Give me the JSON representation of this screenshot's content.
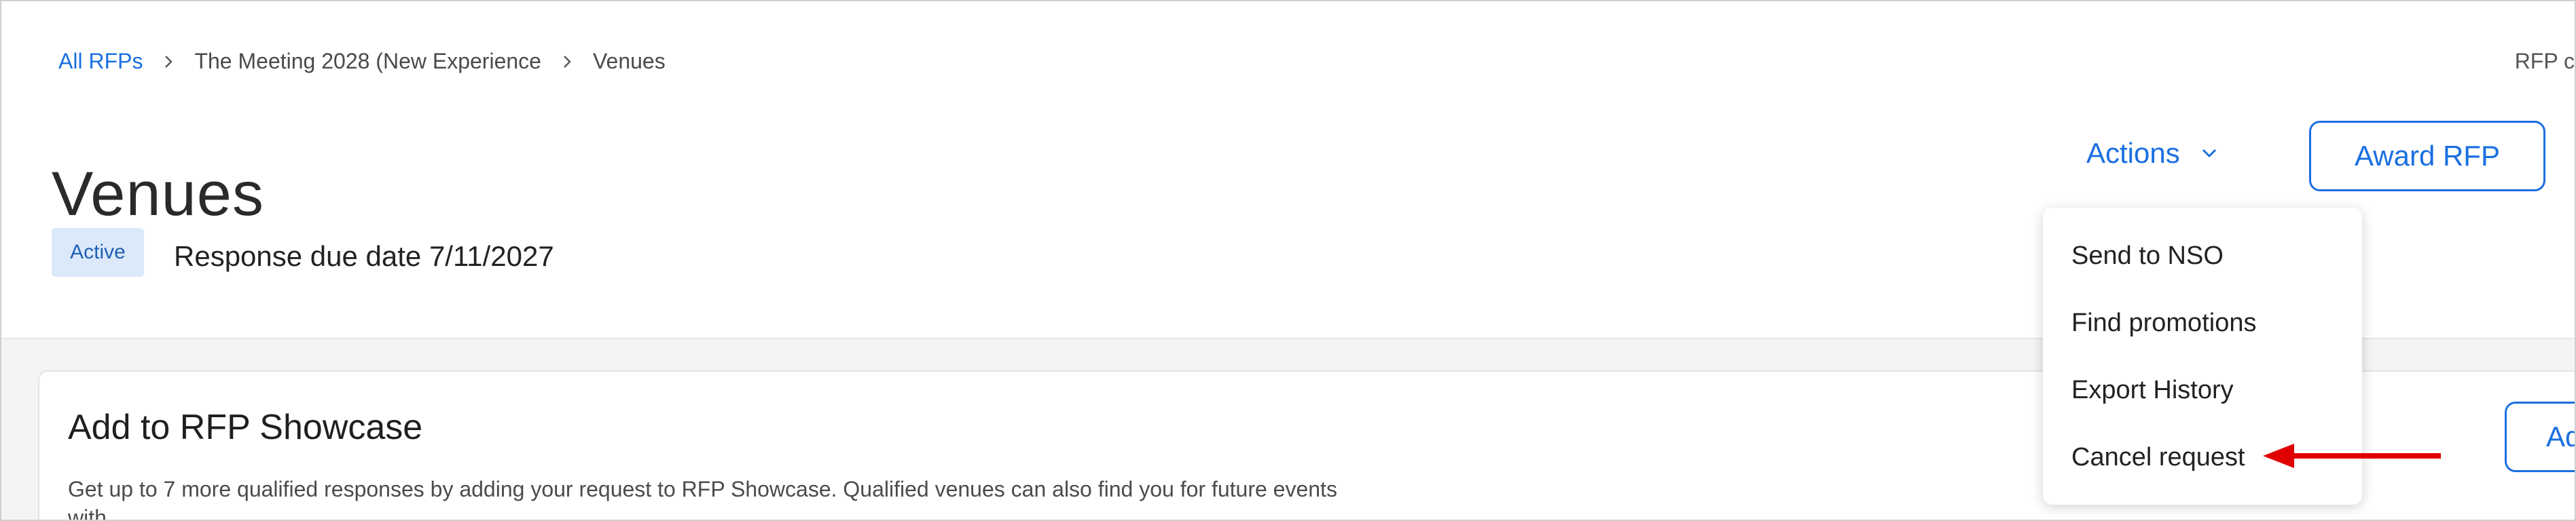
{
  "breadcrumb": {
    "root": "All RFPs",
    "parent": "The Meeting 2028 (New Experience",
    "current": "Venues"
  },
  "header": {
    "corner_text": "RFP c",
    "title": "Venues",
    "status": "Active",
    "due_date": "Response due date 7/11/2027"
  },
  "toolbar": {
    "actions_label": "Actions",
    "award_label": "Award RFP"
  },
  "actions_menu": {
    "items": [
      "Send to NSO",
      "Find promotions",
      "Export History",
      "Cancel request"
    ],
    "highlighted_item": "Cancel request"
  },
  "showcase": {
    "title": "Add to RFP Showcase",
    "description": "Get up to 7 more qualified responses by adding your request to RFP Showcase. Qualified venues can also find you for future events with",
    "button_label": "Ad"
  },
  "colors": {
    "accent": "#1a6fe0",
    "badge_bg": "#dbe9fb",
    "annotation_arrow": "#e00000"
  },
  "icons": {
    "breadcrumb_separator": "chevron-right-icon",
    "actions_chevron": "chevron-down-icon",
    "annotation": "red-arrow-icon"
  }
}
